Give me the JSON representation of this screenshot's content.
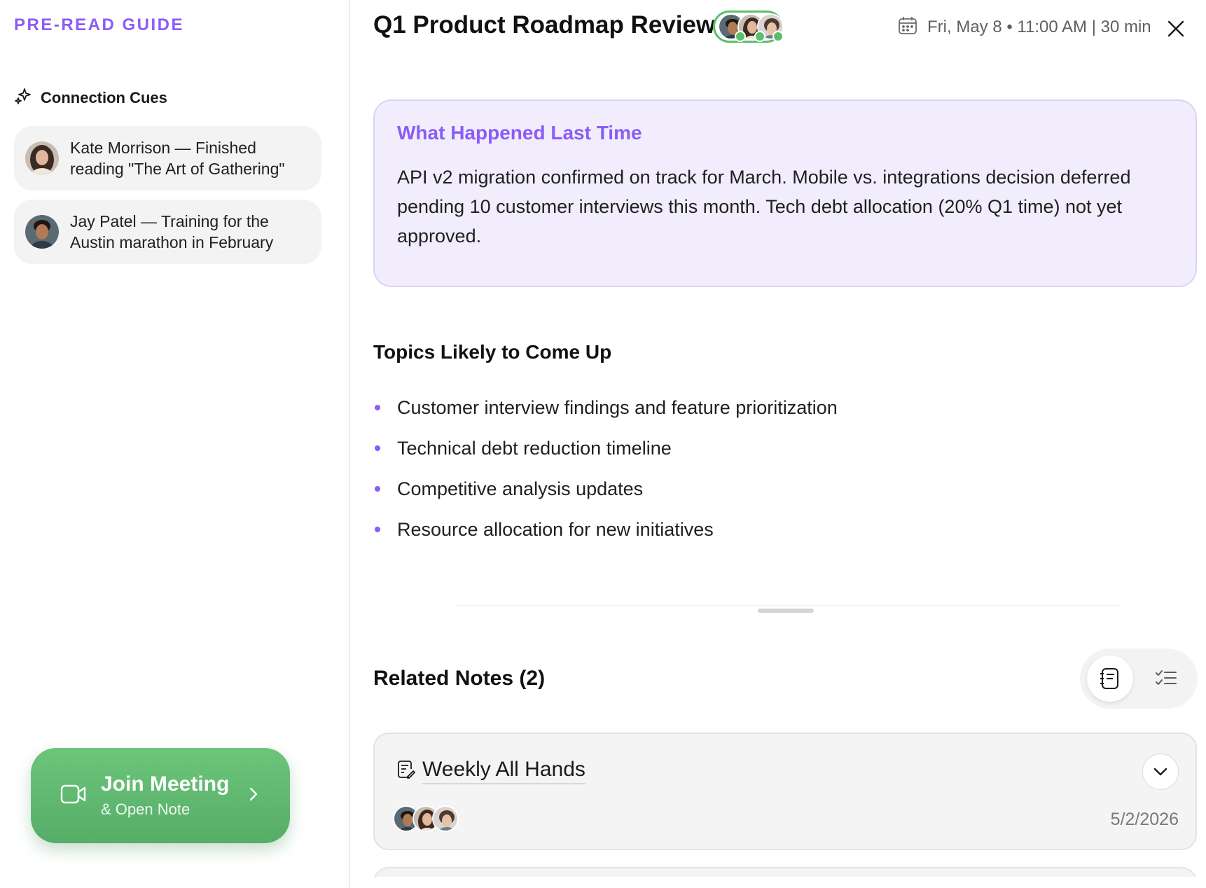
{
  "app": {
    "brand": "PRE-READ GUIDE"
  },
  "meeting": {
    "title": "Q1 Product Roadmap Review",
    "datetime": "Fri, May 8 • 11:00 AM | 30 min",
    "attendee_count_shown": 3
  },
  "sidebar": {
    "cues_title": "Connection Cues",
    "cues": [
      {
        "text": "Kate Morrison — Finished reading \"The Art of Gathering\""
      },
      {
        "text": "Jay Patel — Training for the Austin marathon in February"
      }
    ],
    "join_button": {
      "label": "Join Meeting",
      "sublabel": "& Open Note"
    }
  },
  "recap": {
    "heading": "What Happened Last Time",
    "body": "API v2 migration confirmed on track for March. Mobile vs. integrations decision deferred pending 10 customer interviews this month. Tech debt allocation (20% Q1 time) not yet approved."
  },
  "topics": {
    "heading": "Topics Likely to Come Up",
    "items": [
      "Customer interview findings and feature prioritization",
      "Technical debt reduction timeline",
      "Competitive analysis updates",
      "Resource allocation for new initiatives"
    ]
  },
  "related": {
    "heading": "Related Notes (2)",
    "view_options": [
      "notes-view-icon",
      "checklist-view-icon"
    ],
    "active_view": "notes-view-icon",
    "notes": [
      {
        "title": "Weekly All Hands",
        "date": "5/2/2026"
      }
    ]
  },
  "colors": {
    "accent": "#8b5cf6",
    "recap_bg": "#f1edfd",
    "join_green": "#5eb86e",
    "attendee_ring": "#5bbf6a"
  }
}
